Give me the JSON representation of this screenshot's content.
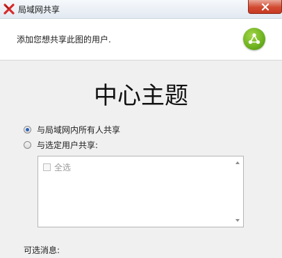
{
  "window": {
    "title": "局域网共享",
    "app_icon": "xmind-x-icon",
    "close_icon": "close-icon"
  },
  "header": {
    "description": "添加您想共享此图的用户.",
    "badge_icon": "share-icon",
    "badge_color": "#6cb11e"
  },
  "main": {
    "topic_title": "中心主题",
    "share_options": [
      {
        "label": "与局域网内所有人共享",
        "selected": true
      },
      {
        "label": "与选定用户共享:",
        "selected": false
      }
    ],
    "user_list": {
      "select_all_label": "全选",
      "select_all_checked": false,
      "enabled": false
    },
    "optional_message_label": "可选消息:"
  }
}
